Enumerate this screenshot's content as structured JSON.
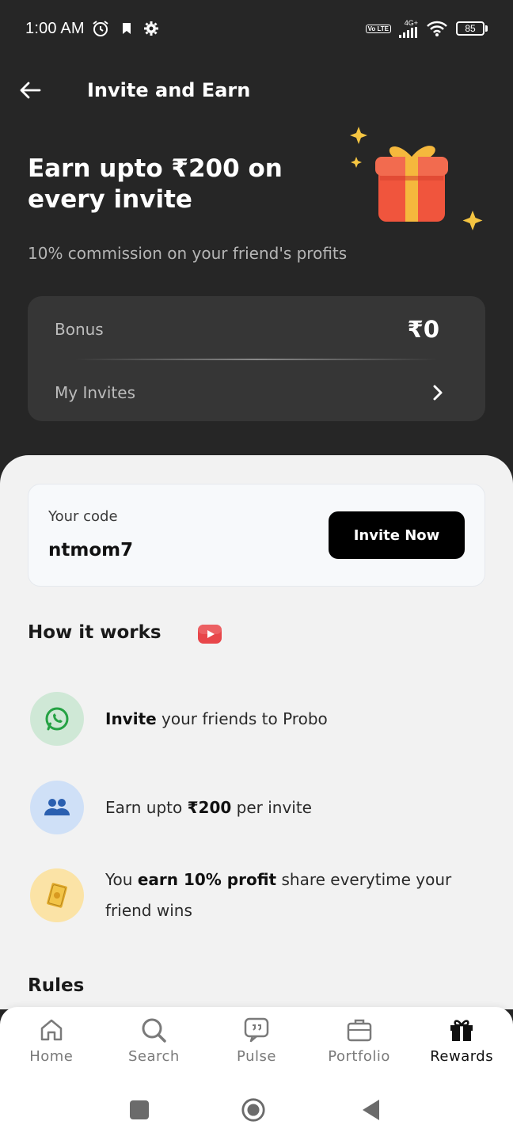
{
  "status": {
    "time": "1:00 AM",
    "volte": "Vo LTE",
    "network": "4G+",
    "battery": "85"
  },
  "header": {
    "title": "Invite and Earn"
  },
  "hero": {
    "title": "Earn upto ₹200 on every invite",
    "subtitle": "10% commission on your friend's profits"
  },
  "bonus_card": {
    "bonus_label": "Bonus",
    "bonus_value": "₹0",
    "invites_label": "My Invites"
  },
  "code_card": {
    "code_label": "Your code",
    "code_value": "ntmom7",
    "invite_button": "Invite Now"
  },
  "how_it_works": {
    "title": "How it works",
    "steps": [
      {
        "bold": "Invite",
        "text": " your friends to Probo",
        "icon": "whatsapp-icon"
      },
      {
        "pre": "Earn upto ",
        "bold": "₹200",
        "text": " per invite",
        "icon": "users-icon"
      },
      {
        "pre": "You ",
        "bold": "earn 10% profit",
        "text": " share everytime your friend wins",
        "icon": "money-icon"
      }
    ]
  },
  "rules": {
    "title": "Rules"
  },
  "bottom_nav": [
    {
      "label": "Home",
      "icon": "home-icon",
      "active": false
    },
    {
      "label": "Search",
      "icon": "search-icon",
      "active": false
    },
    {
      "label": "Pulse",
      "icon": "pulse-icon",
      "active": false
    },
    {
      "label": "Portfolio",
      "icon": "briefcase-icon",
      "active": false
    },
    {
      "label": "Rewards",
      "icon": "gift-icon",
      "active": true
    }
  ],
  "colors": {
    "dark_bg": "#262626",
    "card_bg": "#363636",
    "sheet_bg": "#f2f2f2",
    "button": "#000000"
  }
}
